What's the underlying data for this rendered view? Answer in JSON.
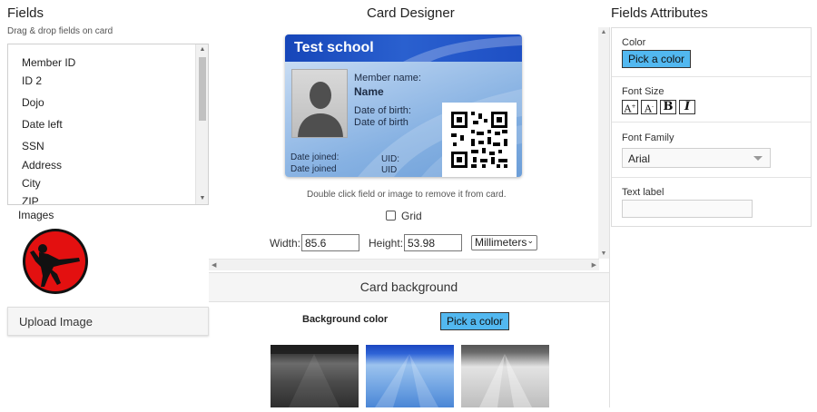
{
  "fields_panel": {
    "title": "Fields",
    "hint": "Drag & drop fields on card",
    "items": [
      "Member ID",
      "ID 2",
      "Dojo",
      "Date left",
      "SSN",
      "Address",
      "City",
      "ZIP"
    ]
  },
  "images_panel": {
    "title": "Images",
    "upload_label": "Upload Image"
  },
  "designer": {
    "title": "Card Designer",
    "card": {
      "school": "Test school",
      "member_name_label": "Member name:",
      "name": "Name",
      "dob_label_1": "Date of birth:",
      "dob_label_2": "Date of birth",
      "joined_1": "Date joined:",
      "joined_2": "Date joined",
      "uid_1": "UID:",
      "uid_2": "UID"
    },
    "hint": "Double click field or image to remove it from card.",
    "grid_label": "Grid",
    "width_label": "Width:",
    "width_value": "85.6",
    "height_label": "Height:",
    "height_value": "53.98",
    "unit": "Millimeters"
  },
  "background": {
    "title": "Card background",
    "color_label": "Background color",
    "pick_label": "Pick a color"
  },
  "attributes": {
    "title": "Fields Attributes",
    "color_label": "Color",
    "pick_label": "Pick a color",
    "font_size_label": "Font Size",
    "font_family_label": "Font Family",
    "font_family_value": "Arial",
    "text_label": "Text label",
    "text_value": ""
  },
  "colors": {
    "accent": "#52b8f0",
    "card_header": "#1a4fc2"
  },
  "icons": [
    "karate-logo-icon",
    "chevron-down-icon",
    "scroll-up-icon",
    "scroll-down-icon",
    "scroll-left-icon",
    "scroll-right-icon",
    "font-increase-icon",
    "font-decrease-icon",
    "bold-icon",
    "italic-icon"
  ]
}
